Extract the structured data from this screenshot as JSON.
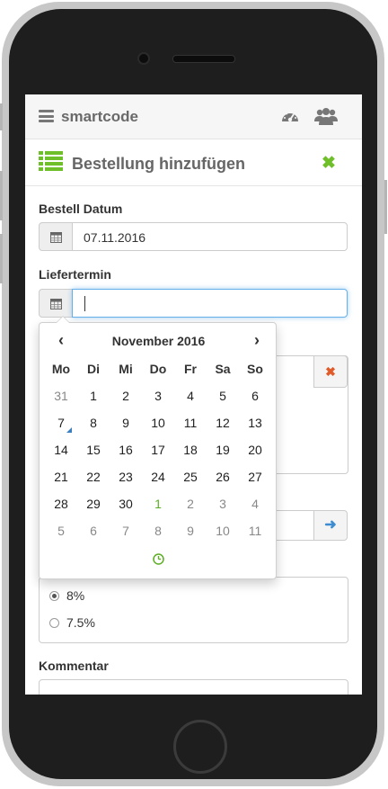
{
  "app": {
    "brand": "smartcode"
  },
  "header": {
    "title": "Bestellung hinzufügen"
  },
  "form": {
    "order_date_label": "Bestell Datum",
    "order_date_value": "07.11.2016",
    "delivery_label": "Liefertermin",
    "delivery_value": "",
    "vat_options": [
      {
        "label": "8%",
        "checked": true
      },
      {
        "label": "7.5%",
        "checked": false
      }
    ],
    "comment_label": "Kommentar"
  },
  "datepicker": {
    "month_title": "November 2016",
    "weekdays": [
      "Mo",
      "Di",
      "Mi",
      "Do",
      "Fr",
      "Sa",
      "So"
    ],
    "weeks": [
      [
        "31",
        "1",
        "2",
        "3",
        "4",
        "5",
        "6"
      ],
      [
        "7",
        "8",
        "9",
        "10",
        "11",
        "12",
        "13"
      ],
      [
        "14",
        "15",
        "16",
        "17",
        "18",
        "19",
        "20"
      ],
      [
        "21",
        "22",
        "23",
        "24",
        "25",
        "26",
        "27"
      ],
      [
        "28",
        "29",
        "30",
        "1",
        "2",
        "3",
        "4"
      ],
      [
        "5",
        "6",
        "7",
        "8",
        "9",
        "10",
        "11"
      ]
    ],
    "today": "7"
  },
  "colors": {
    "accent_green": "#6fbf2a",
    "focus_blue": "#66afe9",
    "arrow_blue": "#3b8cd0",
    "remove_orange": "#e05a2a"
  },
  "icons": {
    "menu": "hamburger-icon",
    "dashboard": "dashboard-icon",
    "users": "users-icon",
    "list": "list-icon",
    "close": "close-icon",
    "calendar": "calendar-icon",
    "remove": "remove-icon",
    "arrow": "arrow-right-icon",
    "clock": "clock-icon",
    "prev": "chevron-left-icon",
    "next": "chevron-right-icon"
  }
}
